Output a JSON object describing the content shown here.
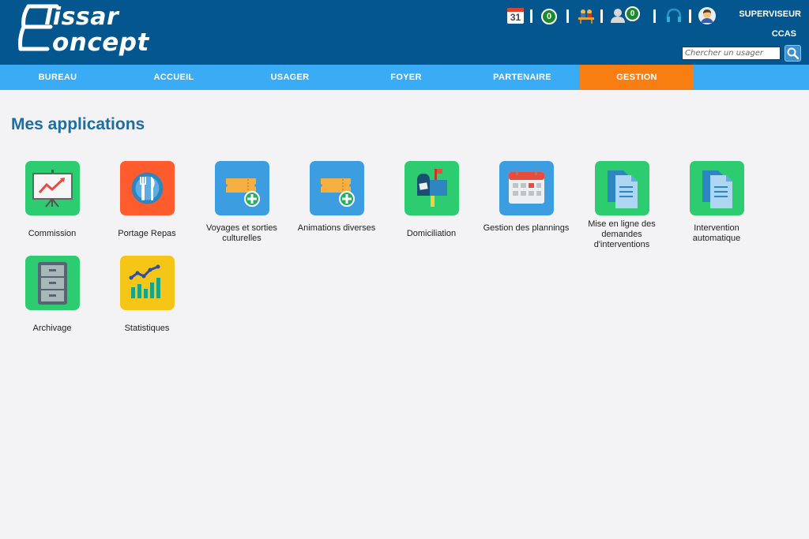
{
  "brand": {
    "line1": "lissar",
    "line2": "oncept"
  },
  "header": {
    "calendar_day": "31",
    "messages_count": "0",
    "users_count": "0",
    "user_role": "SUPERVISEUR",
    "organisation": "CCAS",
    "search_placeholder": "Chercher un usager"
  },
  "nav": {
    "items": [
      {
        "label": "BUREAU"
      },
      {
        "label": "ACCUEIL"
      },
      {
        "label": "USAGER"
      },
      {
        "label": "FOYER"
      },
      {
        "label": "PARTENAIRE"
      },
      {
        "label": "GESTION"
      }
    ],
    "active": "GESTION"
  },
  "main": {
    "title": "Mes applications",
    "apps": [
      {
        "label": "Commission",
        "icon": "presentation-chart-icon",
        "color": "#2ecc71"
      },
      {
        "label": "Portage Repas",
        "icon": "cutlery-plate-icon",
        "color": "#ff5c2e"
      },
      {
        "label": "Voyages et sorties culturelles",
        "icon": "ticket-add-icon",
        "color": "#3c9ee0"
      },
      {
        "label": "Animations diverses",
        "icon": "ticket-add-icon",
        "color": "#3c9ee0"
      },
      {
        "label": "Domiciliation",
        "icon": "mailbox-icon",
        "color": "#2ecc71"
      },
      {
        "label": "Gestion des plannings",
        "icon": "calendar-icon",
        "color": "#3c9ee0"
      },
      {
        "label": "Mise en ligne des demandes d'interventions",
        "icon": "documents-icon",
        "color": "#2ecc71"
      },
      {
        "label": "Intervention automatique",
        "icon": "documents-icon",
        "color": "#2ecc71"
      },
      {
        "label": "Archivage",
        "icon": "filing-cabinet-icon",
        "color": "#2ecc71"
      },
      {
        "label": "Statistiques",
        "icon": "bar-chart-icon",
        "color": "#f5c518"
      }
    ]
  }
}
